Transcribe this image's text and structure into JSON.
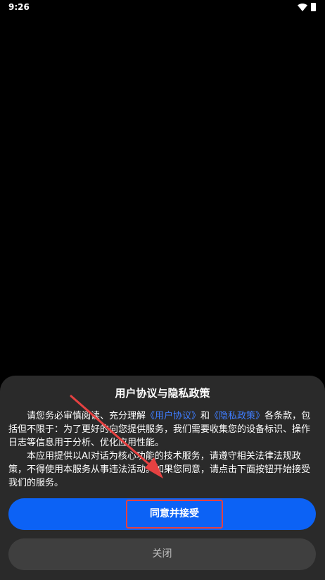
{
  "status_bar": {
    "time": "9:26"
  },
  "dialog": {
    "title": "用户协议与隐私政策",
    "para1_pre": "请您务必审慎阅读、充分理解",
    "link_user_agreement": "《用户协议》",
    "para1_and": "和",
    "link_privacy_policy": "《隐私政策》",
    "para1_post": "各条款，包括但不限于：为了更好的向您提供服务，我们需要收集您的设备标识、操作日志等信息用于分析、优化应用性能。",
    "para2": "本应用提供以AI对话为核心功能的技术服务，请遵守相关法律法规政策，不得使用本服务从事违法活动。如果您同意，请点击下面按钮开始接受我们的服务。",
    "agree_label": "同意并接受",
    "close_label": "关闭"
  },
  "colors": {
    "accent": "#0c62f5",
    "link": "#3f7dff",
    "annotation": "#e54141"
  },
  "icons": [
    "wifi-icon",
    "battery-icon"
  ]
}
